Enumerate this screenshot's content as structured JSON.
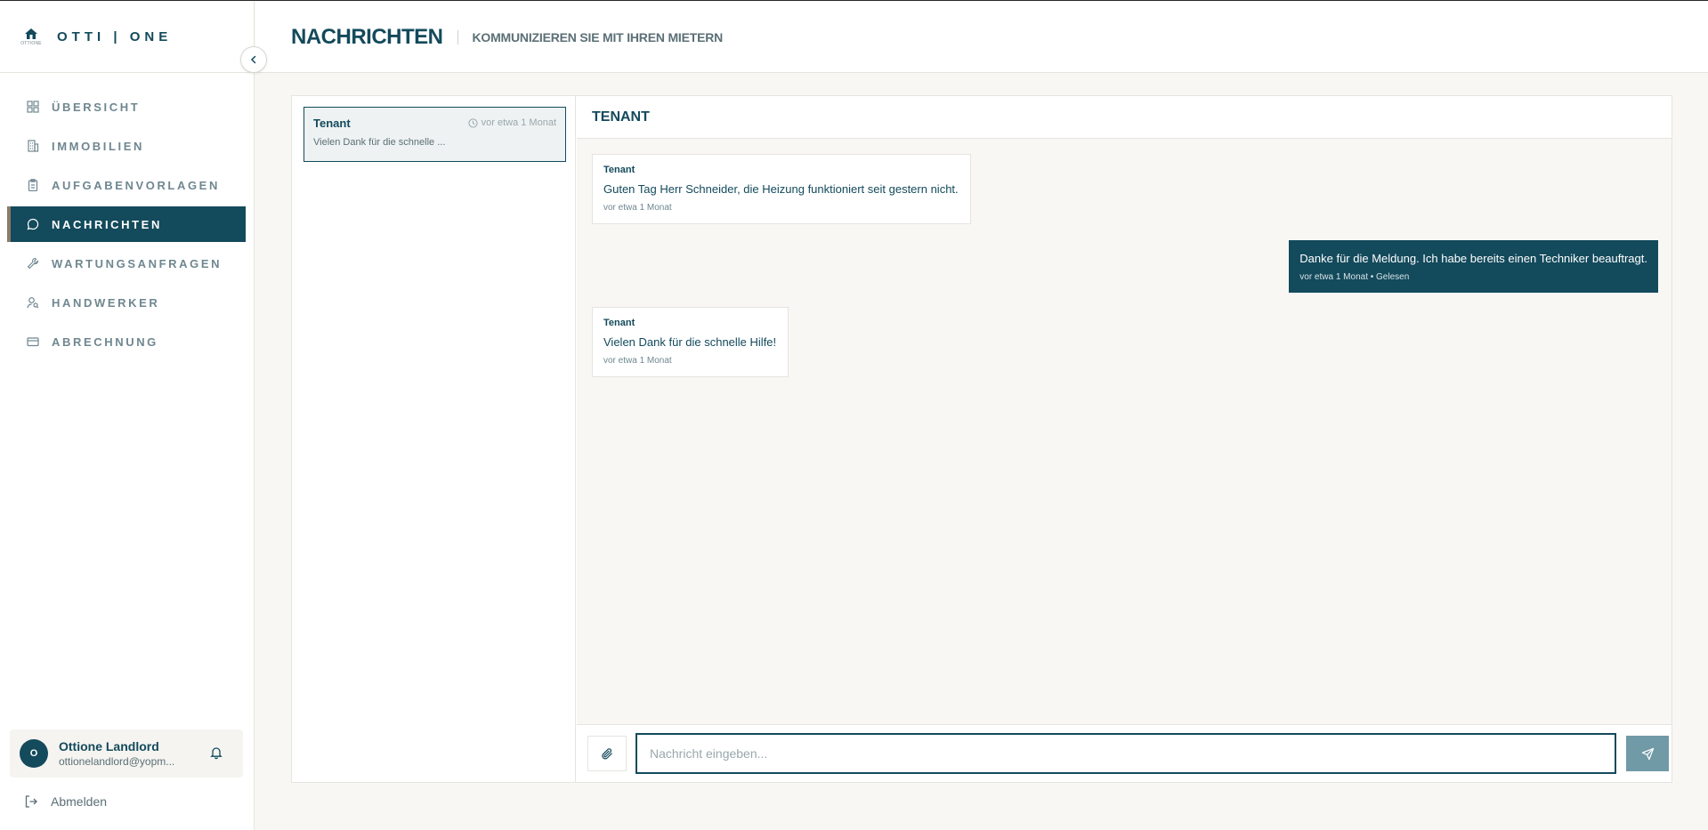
{
  "brand": {
    "name": "OTTI | ONE",
    "logo_sub": "OTTIONE"
  },
  "sidebar": {
    "items": [
      {
        "label": "ÜBERSICHT",
        "icon": "grid-icon"
      },
      {
        "label": "IMMOBILIEN",
        "icon": "building-icon"
      },
      {
        "label": "AUFGABENVORLAGEN",
        "icon": "clipboard-icon"
      },
      {
        "label": "NACHRICHTEN",
        "icon": "message-icon",
        "active": true
      },
      {
        "label": "WARTUNGSANFRAGEN",
        "icon": "wrench-icon"
      },
      {
        "label": "HANDWERKER",
        "icon": "user-search-icon"
      },
      {
        "label": "ABRECHNUNG",
        "icon": "credit-card-icon"
      }
    ]
  },
  "user": {
    "initial": "O",
    "name": "Ottione Landlord",
    "email": "ottionelandlord@yopm..."
  },
  "logout_label": "Abmelden",
  "header": {
    "title": "NACHRICHTEN",
    "subtitle": "KOMMUNIZIEREN SIE MIT IHREN MIETERN"
  },
  "conversations": [
    {
      "name": "Tenant",
      "time": "vor etwa 1 Monat",
      "preview": "Vielen Dank für die schnelle ..."
    }
  ],
  "chat": {
    "title": "TENANT",
    "messages": [
      {
        "direction": "in",
        "sender": "Tenant",
        "text": "Guten Tag Herr Schneider, die Heizung funktioniert seit gestern nicht.",
        "time": "vor etwa 1 Monat"
      },
      {
        "direction": "out",
        "text": "Danke für die Meldung. Ich habe bereits einen Techniker beauftragt.",
        "time": "vor etwa 1 Monat • Gelesen"
      },
      {
        "direction": "in",
        "sender": "Tenant",
        "text": "Vielen Dank für die schnelle Hilfe!",
        "time": "vor etwa 1 Monat"
      }
    ],
    "input_placeholder": "Nachricht eingeben...",
    "input_value": ""
  },
  "colors": {
    "primary": "#134a5c",
    "accent": "#8c7a68",
    "background": "#f8f7f4",
    "send": "#6f9aa6"
  }
}
